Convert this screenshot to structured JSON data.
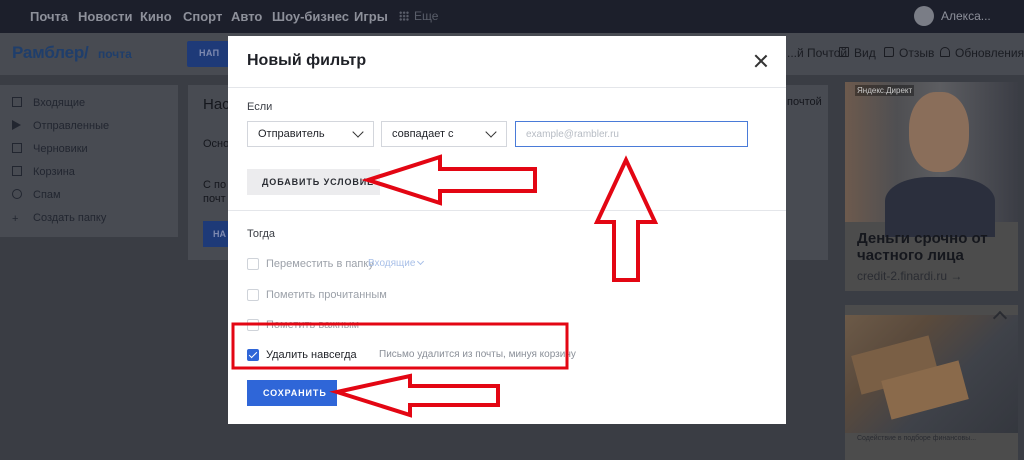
{
  "topnav": {
    "links": [
      "Почта",
      "Новости",
      "Кино",
      "Спорт",
      "Авто",
      "Шоу-бизнес",
      "Игры"
    ],
    "more": "Еще",
    "user": "Алекса..."
  },
  "header": {
    "logo": "Рамблер/",
    "logo_sub": "почта",
    "write_label": "НАП",
    "right_items": [
      "...й Почтой",
      "Вид",
      "Отзыв",
      "Обновления"
    ]
  },
  "sidebar": {
    "items": [
      {
        "label": "Входящие",
        "icon": "inbox-icon"
      },
      {
        "label": "Отправленные",
        "icon": "send-icon"
      },
      {
        "label": "Черновики",
        "icon": "draft-icon"
      },
      {
        "label": "Корзина",
        "icon": "trash-icon"
      },
      {
        "label": "Спам",
        "icon": "spam-icon"
      },
      {
        "label": "Создать папку",
        "icon": "plus-icon"
      }
    ]
  },
  "background": {
    "title": "Нас",
    "line1": "Осно",
    "line2a": "С по",
    "line2b": "почт",
    "button": "НА",
    "right": "почтой"
  },
  "ads": {
    "ad1_tag": "Яндекс.Директ",
    "ad1_headline": "Деньги срочно от частного лица",
    "ad1_domain": "credit-2.finardi.ru →",
    "ad2_caption": "Содействие в подборе финансовы..."
  },
  "modal": {
    "title": "Новый фильтр",
    "if_label": "Если",
    "field_select": "Отправитель",
    "condition_select": "совпадает с",
    "email_placeholder": "example@rambler.ru",
    "email_value": "",
    "add_condition": "ДОБАВИТЬ УСЛОВИЕ",
    "then_label": "Тогда",
    "actions": [
      {
        "label": "Переместить в папку",
        "checked": false
      },
      {
        "label": "Пометить прочитанным",
        "checked": false
      },
      {
        "label": "Пометить важным",
        "checked": false
      },
      {
        "label": "Удалить навсегда",
        "checked": true
      }
    ],
    "folder_value": "Входящие",
    "delete_hint": "Письмо удалится из почты, минуя корзину",
    "save": "СОХРАНИТЬ"
  },
  "colors": {
    "accent": "#2f66d8",
    "annotation": "#e30613"
  }
}
